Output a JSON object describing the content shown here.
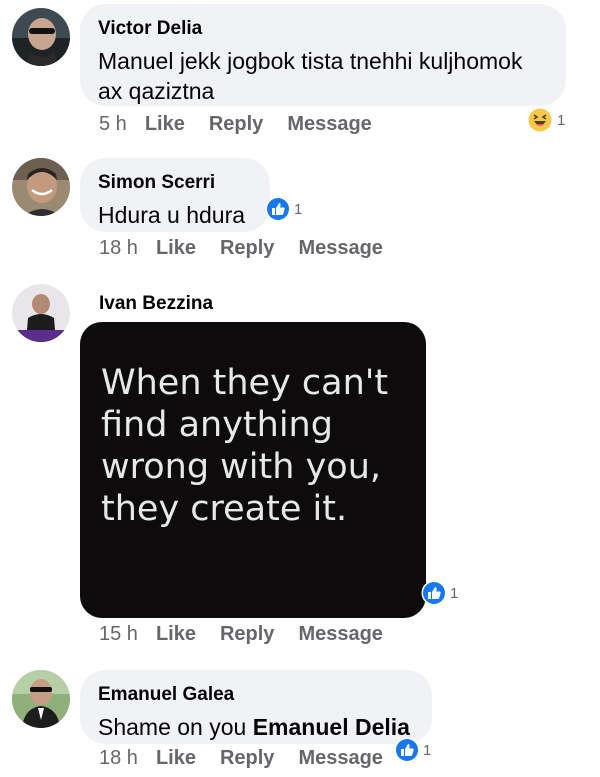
{
  "comments": [
    {
      "name": "Victor Delia",
      "text": "Manuel jekk jogbok tista tnehhi kuljhomok ax qaziztna",
      "time": "5 h",
      "like": "Like",
      "reply": "Reply",
      "message": "Message",
      "reaction": {
        "type": "haha-icon",
        "count": "1"
      }
    },
    {
      "name": "Simon Scerri",
      "text": "Hdura u hdura",
      "time": "18 h",
      "like": "Like",
      "reply": "Reply",
      "message": "Message",
      "reaction": {
        "type": "like-icon",
        "count": "1"
      }
    },
    {
      "name": "Ivan Bezzina",
      "image_text": [
        "When they can't",
        "find anything",
        "wrong with you,",
        "they create it."
      ],
      "time": "15 h",
      "like": "Like",
      "reply": "Reply",
      "message": "Message",
      "reaction": {
        "type": "like-icon",
        "count": "1"
      }
    },
    {
      "name": "Emanuel Galea",
      "text_prefix": "Shame on you",
      "mention": "Emanuel Delia",
      "time": "18 h",
      "like": "Like",
      "reply": "Reply",
      "message": "Message",
      "reaction": {
        "type": "like-icon",
        "count": "1"
      }
    }
  ],
  "colors": {
    "bubble": "#f0f2f5",
    "meta": "#65676b",
    "like_blue": "#1877f2",
    "haha_yellow": "#f7c94b"
  }
}
